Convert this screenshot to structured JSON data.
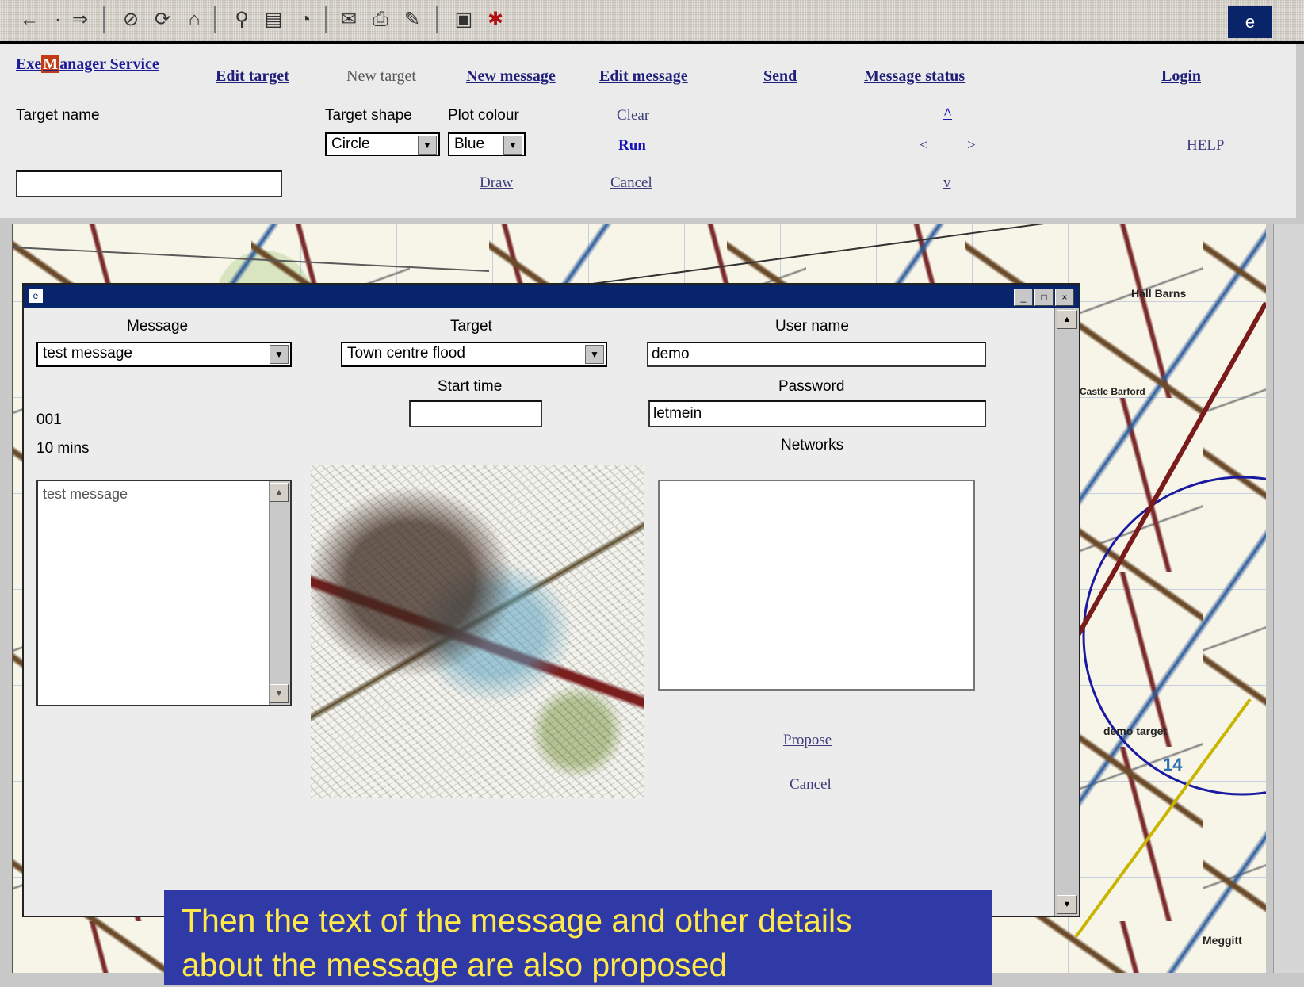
{
  "toolbar": {
    "icons": [
      "back-icon",
      "forward-icon",
      "stop-icon",
      "refresh-icon",
      "home-icon",
      "search-icon",
      "favorites-icon",
      "history-icon",
      "mail-icon",
      "print-icon",
      "edit-icon",
      "discuss-icon",
      "messenger-icon"
    ]
  },
  "header": {
    "logo_part1": "Exe",
    "logo_accent": "M",
    "logo_part2": "anager",
    "logo_part3": " Service",
    "nav": {
      "edit_target": "Edit target",
      "new_target": "New target",
      "new_message": "New message",
      "edit_message": "Edit message",
      "send": "Send",
      "message_status": "Message status",
      "login": "Login"
    },
    "target_name_label": "Target name",
    "target_name_value": "",
    "target_shape_label": "Target shape",
    "target_shape_value": "Circle",
    "plot_colour_label": "Plot colour",
    "plot_colour_value": "Blue",
    "clear": "Clear",
    "run": "Run",
    "draw": "Draw",
    "cancel": "Cancel",
    "arrows": {
      "up": "^",
      "left": "<",
      "right": ">",
      "down": "v"
    },
    "help": "HELP"
  },
  "map": {
    "labels": [
      "Hall Barns",
      "Castle Barford",
      "demo target",
      "Meggitt",
      "14"
    ]
  },
  "dialog": {
    "title": "",
    "message_label": "Message",
    "message_value": "test message",
    "target_label": "Target",
    "target_value": "Town centre flood",
    "user_name_label": "User name",
    "user_name_value": "demo",
    "start_time_label": "Start time",
    "start_time_value": "",
    "password_label": "Password",
    "password_value": "letmein",
    "priority": "001",
    "duration": "10 mins",
    "networks_label": "Networks",
    "message_text": "test message",
    "propose": "Propose",
    "cancel": "Cancel"
  },
  "caption": {
    "line1": "Then the text of the message and other details",
    "line2": "about the message are also proposed"
  },
  "colors": {
    "dialog_title_bg": "#08246b",
    "caption_bg": "#2f3aa6",
    "caption_text": "#ffe94a"
  }
}
